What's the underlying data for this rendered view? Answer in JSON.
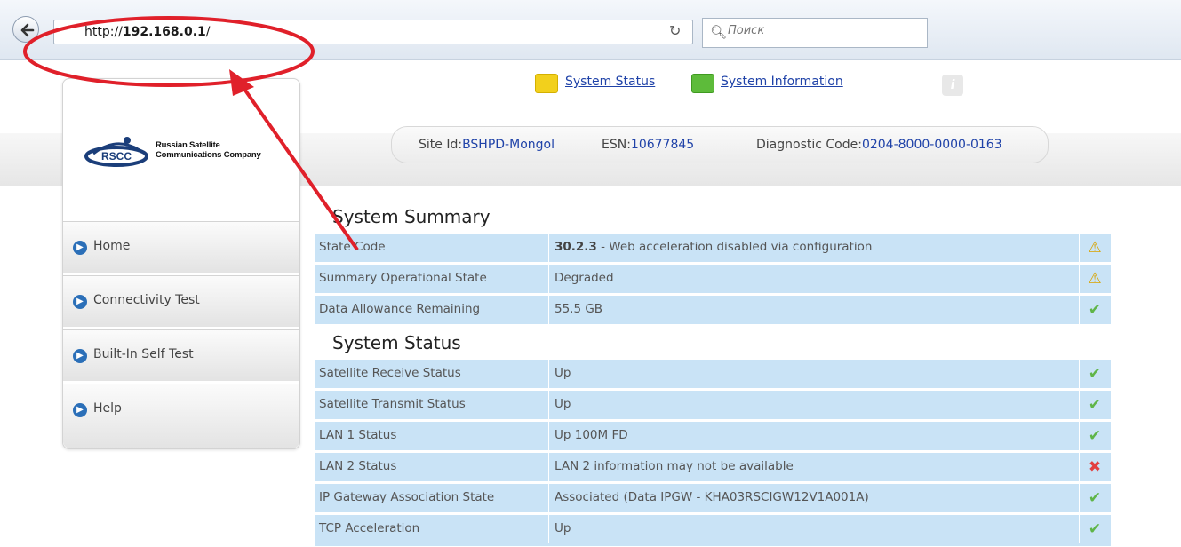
{
  "browser": {
    "url_prefix": "http://",
    "url_host": "192.168.0.1",
    "url_suffix": "/",
    "search_placeholder": "Поиск"
  },
  "top_links": {
    "system_status": "System Status",
    "system_information": "System Information"
  },
  "info_bar": {
    "site_label": "Site Id:",
    "site_value": "BSHPD-Mongol",
    "esn_label": "ESN:",
    "esn_value": "10677845",
    "diag_label": "Diagnostic Code:",
    "diag_value": "0204-8000-0000-0163"
  },
  "logo": {
    "line1": "Russian Satellite",
    "line2": "Communications Company",
    "mark": "RSCC"
  },
  "sidebar": {
    "items": [
      {
        "label": "Home"
      },
      {
        "label": "Connectivity Test"
      },
      {
        "label": "Built-In Self Test"
      },
      {
        "label": "Help"
      }
    ]
  },
  "summary": {
    "title": "System Summary",
    "rows": [
      {
        "label": "State Code",
        "value_bold": "30.2.3",
        "value": " - Web acceleration disabled via configuration",
        "status": "warning-icon"
      },
      {
        "label": "Summary Operational State",
        "value_bold": "",
        "value": "Degraded",
        "status": "warning-icon"
      },
      {
        "label": "Data Allowance Remaining",
        "value_bold": "",
        "value": "55.5 GB",
        "status": "check-icon"
      }
    ]
  },
  "status": {
    "title": "System Status",
    "rows": [
      {
        "label": "Satellite Receive Status",
        "value": "Up",
        "status": "check-icon"
      },
      {
        "label": "Satellite Transmit Status",
        "value": "Up",
        "status": "check-icon"
      },
      {
        "label": "LAN 1 Status",
        "value": "Up 100M FD",
        "status": "check-icon"
      },
      {
        "label": "LAN 2 Status",
        "value": "LAN 2 information may not be available",
        "status": "cross-icon"
      },
      {
        "label": "IP Gateway Association State",
        "value": "Associated (Data IPGW - KHA03RSCIGW12V1A001A)",
        "status": "check-icon"
      },
      {
        "label": "TCP Acceleration",
        "value": "Up",
        "status": "check-icon"
      }
    ]
  },
  "colors": {
    "row_bg": "#c9e3f6",
    "link": "#1f42a8",
    "annotation": "#e0202a",
    "status_link_icon": "#f2d01c",
    "info_link_icon": "#5dbb3a"
  }
}
